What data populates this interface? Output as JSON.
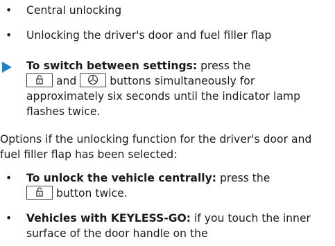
{
  "top_bullets": [
    {
      "bullet": "•",
      "text": "Central unlocking"
    },
    {
      "bullet": "•",
      "text": "Unlocking the driver's door and fuel filler flap"
    }
  ],
  "step": {
    "icon": "arrow-right-icon",
    "icon_color": "#1d83c6",
    "title": "To switch between settings:",
    "text_1": " press the",
    "key_1_icon": "unlock-key-icon",
    "text_2": " and ",
    "key_2_icon": "lock-key-icon",
    "text_3": " buttons simultaneously for approximately six seconds until the indicator lamp flashes twice."
  },
  "options_text": "Options if the unlocking function for the driver's door and fuel filler flap has been selected:",
  "bottom_bullets": [
    {
      "bullet": "•",
      "title": "To unlock the vehicle centrally:",
      "text_1": " press the",
      "key_icon": "unlock-key-icon",
      "text_2": " button twice."
    },
    {
      "bullet": "•",
      "title": "Vehicles with KEYLESS-GO:",
      "text_1": " if you touch the inner surface of the door handle on the"
    }
  ]
}
